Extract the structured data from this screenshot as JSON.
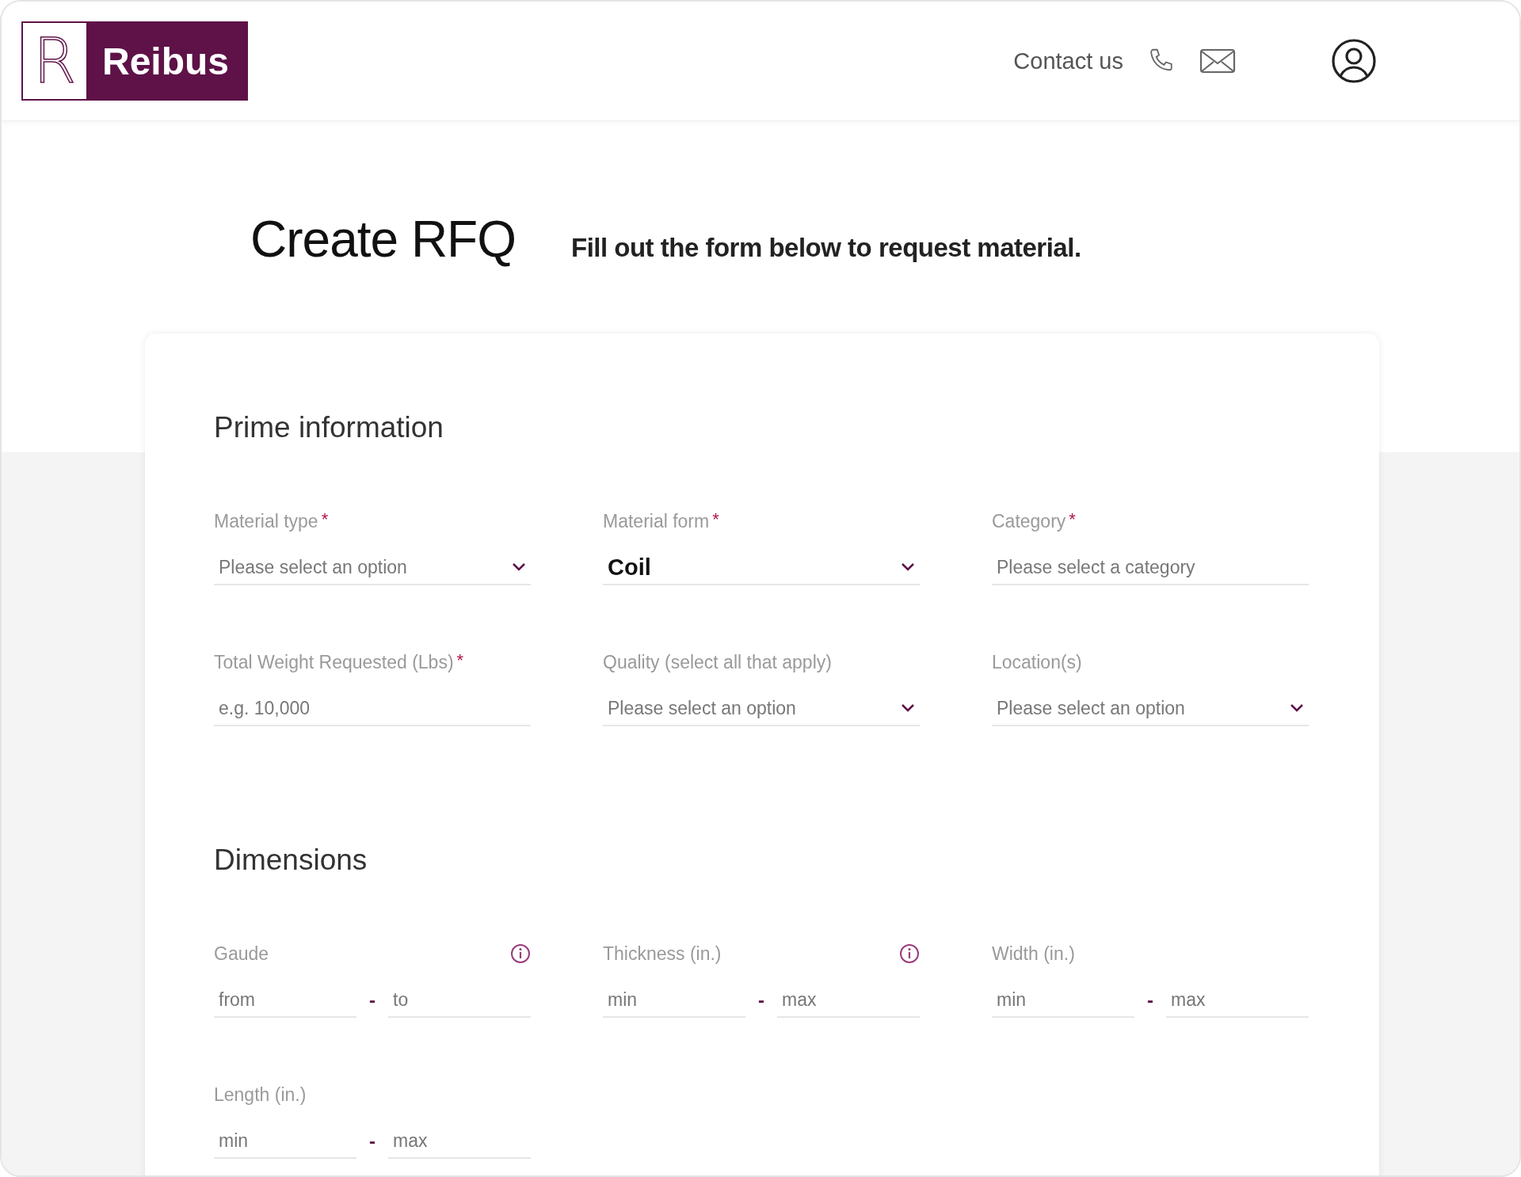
{
  "header": {
    "logo_letter": "R",
    "logo_name": "Reibus",
    "contact": "Contact us"
  },
  "page": {
    "title": "Create RFQ",
    "subtitle": "Fill out the form below to request material."
  },
  "sections": [
    {
      "title": "Prime information",
      "fields": [
        {
          "kind": "select",
          "label": "Material type",
          "required_mark": "*",
          "placeholder": "Please select an option"
        },
        {
          "kind": "select",
          "label": "Material form",
          "required_mark": "*",
          "value": "Coil"
        },
        {
          "kind": "text",
          "label": "Category",
          "required_mark": "*",
          "placeholder": "Please select a category"
        },
        {
          "kind": "text",
          "label": "Total Weight Requested (Lbs)",
          "required_mark": "*",
          "placeholder": "e.g. 10,000"
        },
        {
          "kind": "select",
          "label": "Quality (select all that apply)",
          "placeholder": "Please select an option"
        },
        {
          "kind": "select",
          "label": "Location(s)",
          "placeholder": "Please select an option"
        }
      ]
    },
    {
      "title": "Dimensions",
      "fields": [
        {
          "kind": "range",
          "label": "Gaude",
          "info": true,
          "placeholder": "from",
          "placeholder_2": "to",
          "separator": "-"
        },
        {
          "kind": "range",
          "label": "Thickness (in.)",
          "info": true,
          "placeholder": "min",
          "placeholder_2": "max",
          "separator": "-"
        },
        {
          "kind": "range",
          "label": "Width (in.)",
          "info": false,
          "placeholder": "min",
          "placeholder_2": "max",
          "separator": "-"
        },
        {
          "kind": "range",
          "label": "Length (in.)",
          "info": false,
          "placeholder": "min",
          "placeholder_2": "max",
          "separator": "-"
        }
      ]
    }
  ]
}
